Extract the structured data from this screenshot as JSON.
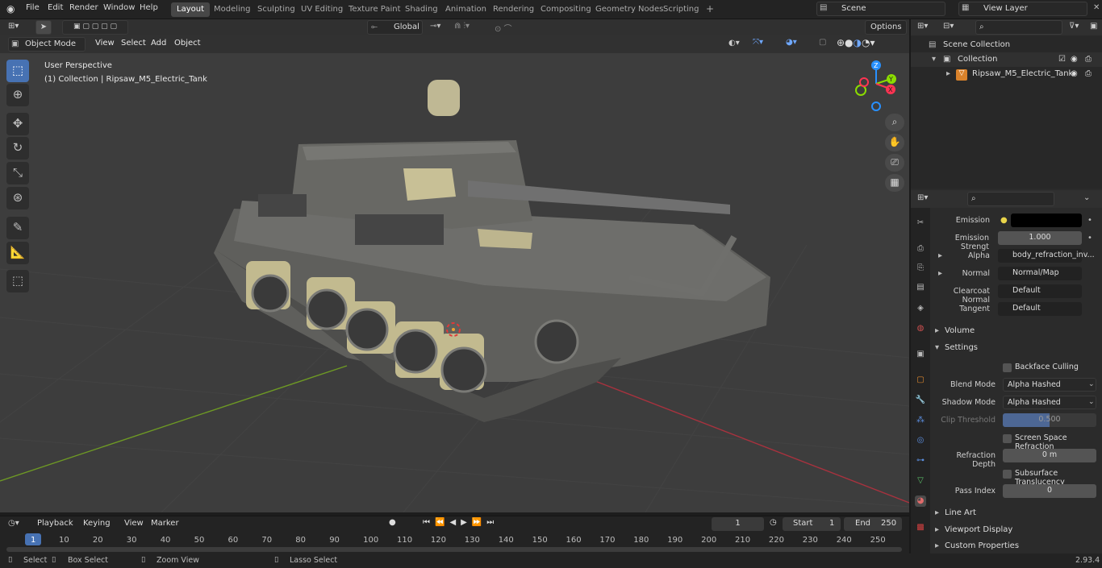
{
  "menu": [
    "File",
    "Edit",
    "Render",
    "Window",
    "Help"
  ],
  "workspaces": [
    "Layout",
    "Modeling",
    "Sculpting",
    "UV Editing",
    "Texture Paint",
    "Shading",
    "Animation",
    "Rendering",
    "Compositing",
    "Geometry Nodes",
    "Scripting"
  ],
  "scene": "Scene",
  "view_layer": "View Layer",
  "header": {
    "mode": "Object Mode",
    "menus": [
      "View",
      "Select",
      "Add",
      "Object"
    ],
    "orientation": "Global",
    "options": "Options"
  },
  "viewport": {
    "perspective": "User Perspective",
    "collection_label": "(1) Collection | Ripsaw_M5_Electric_Tank",
    "axes": {
      "z": "Z",
      "y": "Y",
      "x": "X"
    }
  },
  "outliner": {
    "scene_collection": "Scene Collection",
    "collection": "Collection",
    "object": "Ripsaw_M5_Electric_Tank"
  },
  "properties": {
    "emission_label": "Emission",
    "emission_strength_label": "Emission Strengt",
    "emission_strength_value": "1.000",
    "alpha_label": "Alpha",
    "alpha_value": "body_refraction_inv...",
    "normal_label": "Normal",
    "normal_value": "Normal/Map",
    "clearcoat_label": "Clearcoat Normal",
    "clearcoat_value": "Default",
    "tangent_label": "Tangent",
    "tangent_value": "Default",
    "volume": "Volume",
    "settings": "Settings",
    "backface": "Backface Culling",
    "blend_label": "Blend Mode",
    "blend_value": "Alpha Hashed",
    "shadow_label": "Shadow Mode",
    "shadow_value": "Alpha Hashed",
    "clip_label": "Clip Threshold",
    "clip_value": "0.500",
    "ssr": "Screen Space Refraction",
    "refr_label": "Refraction Depth",
    "refr_value": "0 m",
    "subsurface": "Subsurface Translucency",
    "pass_label": "Pass Index",
    "pass_value": "0",
    "line_art": "Line Art",
    "viewport_display": "Viewport Display",
    "custom_props": "Custom Properties"
  },
  "timeline": {
    "menus": [
      "Playback",
      "Keying",
      "View",
      "Marker"
    ],
    "current_frame": "1",
    "start_label": "Start",
    "start": "1",
    "end_label": "End",
    "end": "250",
    "ticks": [
      "1",
      "10",
      "20",
      "30",
      "40",
      "50",
      "60",
      "70",
      "80",
      "90",
      "100",
      "110",
      "120",
      "130",
      "140",
      "150",
      "160",
      "170",
      "180",
      "190",
      "200",
      "210",
      "220",
      "230",
      "240",
      "250"
    ]
  },
  "status": {
    "select": "Select",
    "box_select": "Box Select",
    "zoom": "Zoom View",
    "lasso": "Lasso Select",
    "version": "2.93.4"
  },
  "colors": {
    "accent": "#4772b3",
    "x_axis": "#ff3352",
    "y_axis": "#8bdc00",
    "z_axis": "#2890ff",
    "tank": "#6b6b68",
    "tan": "#c8c096"
  }
}
